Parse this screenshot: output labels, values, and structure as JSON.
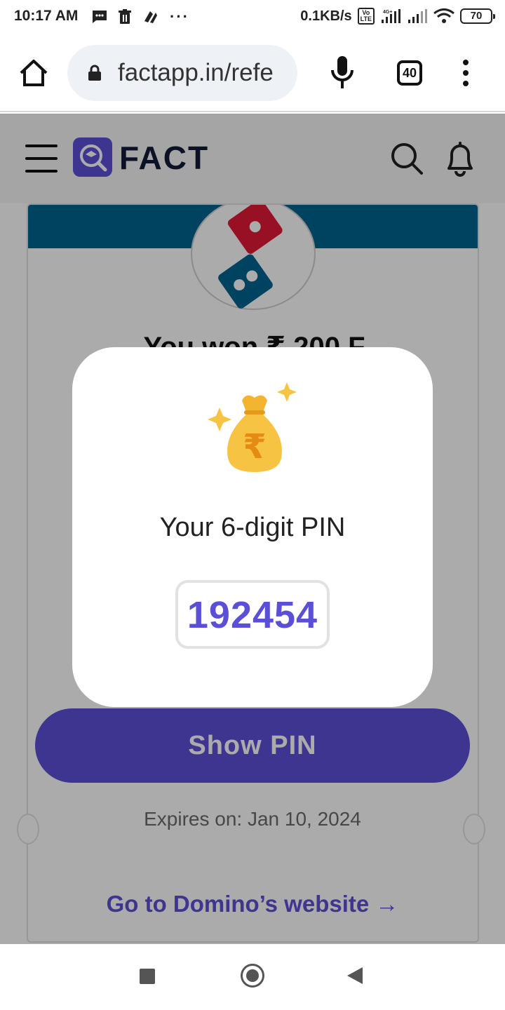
{
  "status_bar": {
    "time": "10:17 AM",
    "speed": "0.1KB/s",
    "network": "4G+",
    "volte": "Vo LTE",
    "battery": "70",
    "icons": [
      "message-icon",
      "trash-icon",
      "app-icon",
      "overflow-dots"
    ]
  },
  "browser": {
    "url": "factapp.in/refe",
    "tab_count": "40",
    "icons": [
      "home-icon",
      "lock-icon",
      "mic-icon",
      "menu-dots-icon"
    ]
  },
  "site_header": {
    "logo_text": "FACT",
    "colors": {
      "brand": "#5b4fd6",
      "logo_text": "#121a3a"
    }
  },
  "card": {
    "headline": "You won ₹ 200 F",
    "show_pin_label": "Show PIN",
    "expires": "Expires on: Jan 10, 2024",
    "goto_link": "Go to Domino’s website →",
    "colors": {
      "banner": "#006491",
      "domino_red": "#e31837",
      "domino_blue": "#006491"
    }
  },
  "modal": {
    "title": "Your 6-digit PIN",
    "pin": "192454",
    "icon": "money-bag-rupee-icon"
  },
  "nav": {
    "icons": [
      "recent-apps-icon",
      "home-circle-icon",
      "back-icon"
    ]
  }
}
